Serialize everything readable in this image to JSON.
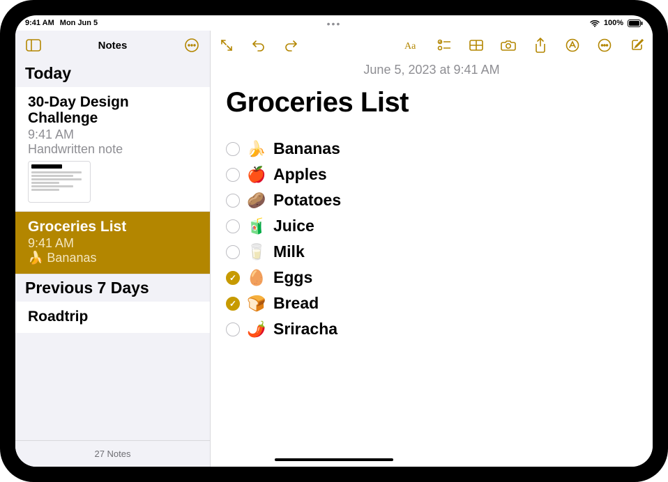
{
  "status": {
    "time": "9:41 AM",
    "date": "Mon Jun 5",
    "battery_pct": "100%"
  },
  "accent": "#b38600",
  "sidebar": {
    "title": "Notes",
    "sections": [
      {
        "header": "Today"
      },
      {
        "header": "Previous 7 Days"
      }
    ],
    "notes": [
      {
        "title": "30-Day Design Challenge",
        "time": "9:41 AM",
        "preview": "Handwritten note",
        "selected": false,
        "has_thumb": true
      },
      {
        "title": "Groceries List",
        "time": "9:41 AM",
        "preview": "🍌 Bananas",
        "selected": true,
        "has_thumb": false
      },
      {
        "title": "Roadtrip",
        "time": "",
        "preview": "",
        "selected": false,
        "has_thumb": false
      }
    ],
    "footer": "27 Notes"
  },
  "toolbar_icons": {
    "sidebar_toggle": "sidebar-toggle-icon",
    "sidebar_more": "more-circle-icon",
    "expand": "expand-icon",
    "undo": "undo-icon",
    "redo": "redo-icon",
    "text_format": "text-format-icon",
    "checklist": "checklist-icon",
    "table": "table-icon",
    "camera": "camera-icon",
    "share": "share-icon",
    "markup": "markup-icon",
    "more": "more-circle-icon",
    "compose": "compose-icon"
  },
  "note": {
    "date": "June 5, 2023 at 9:41 AM",
    "title": "Groceries List",
    "items": [
      {
        "emoji": "🍌",
        "label": "Bananas",
        "checked": false
      },
      {
        "emoji": "🍎",
        "label": "Apples",
        "checked": false
      },
      {
        "emoji": "🥔",
        "label": "Potatoes",
        "checked": false
      },
      {
        "emoji": "🧃",
        "label": "Juice",
        "checked": false
      },
      {
        "emoji": "🥛",
        "label": "Milk",
        "checked": false
      },
      {
        "emoji": "🥚",
        "label": "Eggs",
        "checked": true
      },
      {
        "emoji": "🍞",
        "label": "Bread",
        "checked": true
      },
      {
        "emoji": "🌶️",
        "label": "Sriracha",
        "checked": false
      }
    ]
  }
}
